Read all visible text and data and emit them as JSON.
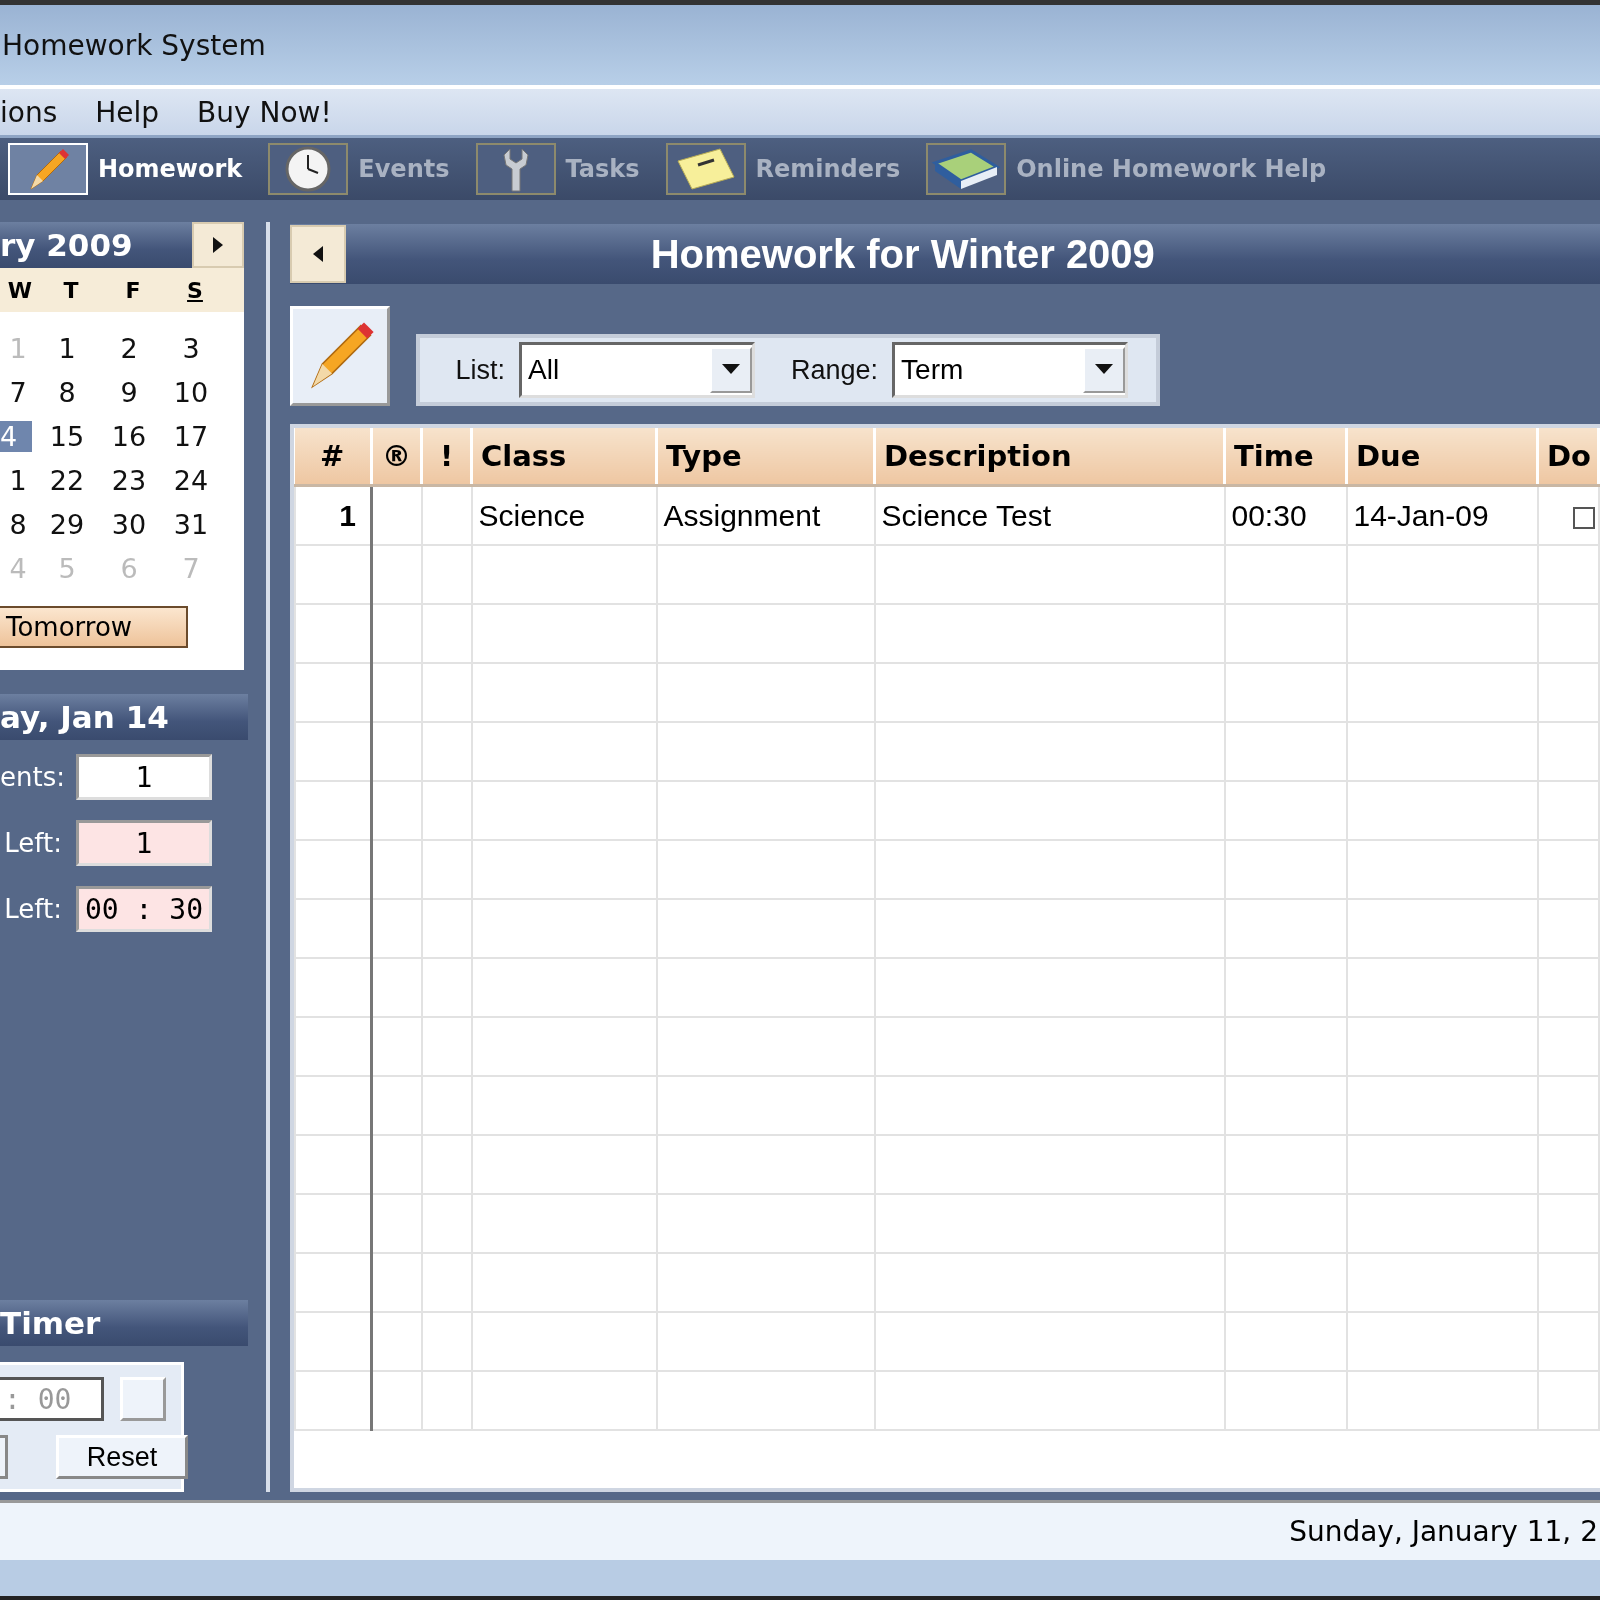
{
  "window": {
    "title": "Homework System"
  },
  "menu": [
    "ions",
    "Help",
    "Buy Now!"
  ],
  "toolbar": [
    {
      "label": "Homework",
      "selected": true
    },
    {
      "label": "Events",
      "selected": false
    },
    {
      "label": "Tasks",
      "selected": false
    },
    {
      "label": "Reminders",
      "selected": false
    },
    {
      "label": "Online Homework Help",
      "selected": false
    }
  ],
  "calendar": {
    "month": "ry 2009",
    "weekdays": [
      "W",
      "T",
      "F",
      "S"
    ],
    "days": [
      [
        {
          "text": "1",
          "muted": true,
          "selected": false
        },
        {
          "text": "1",
          "muted": false,
          "selected": false
        },
        {
          "text": "2",
          "muted": false,
          "selected": false
        },
        {
          "text": "3",
          "muted": false,
          "selected": false
        }
      ],
      [
        {
          "text": "7",
          "muted": false,
          "selected": false
        },
        {
          "text": "8",
          "muted": false,
          "selected": false
        },
        {
          "text": "9",
          "muted": false,
          "selected": false
        },
        {
          "text": "10",
          "muted": false,
          "selected": false
        }
      ],
      [
        {
          "text": "4",
          "muted": false,
          "selected": true
        },
        {
          "text": "15",
          "muted": false,
          "selected": false
        },
        {
          "text": "16",
          "muted": false,
          "selected": false
        },
        {
          "text": "17",
          "muted": false,
          "selected": false
        }
      ],
      [
        {
          "text": "1",
          "muted": false,
          "selected": false
        },
        {
          "text": "22",
          "muted": false,
          "selected": false
        },
        {
          "text": "23",
          "muted": false,
          "selected": false
        },
        {
          "text": "24",
          "muted": false,
          "selected": false
        }
      ],
      [
        {
          "text": "8",
          "muted": false,
          "selected": false
        },
        {
          "text": "29",
          "muted": false,
          "selected": false
        },
        {
          "text": "30",
          "muted": false,
          "selected": false
        },
        {
          "text": "31",
          "muted": false,
          "selected": false
        }
      ],
      [
        {
          "text": "4",
          "muted": true,
          "selected": false
        },
        {
          "text": "5",
          "muted": true,
          "selected": false
        },
        {
          "text": "6",
          "muted": true,
          "selected": false
        },
        {
          "text": "7",
          "muted": true,
          "selected": false
        }
      ]
    ],
    "button": "Tomorrow"
  },
  "day": {
    "title": "ay, Jan 14",
    "stats": [
      {
        "label": "ents:",
        "value": "1",
        "alert": false
      },
      {
        "label": "Left:",
        "value": "1",
        "alert": true
      },
      {
        "label": "Left:",
        "value": "00 : 30",
        "alert": true
      }
    ]
  },
  "timer": {
    "title": "Timer",
    "display": ": 00",
    "button": "Reset"
  },
  "main": {
    "title": "Homework for Winter 2009",
    "filters": [
      {
        "label": "List:",
        "value": "All"
      },
      {
        "label": "Range:",
        "value": "Term"
      }
    ],
    "columns": [
      "#",
      "®",
      "!",
      "Class",
      "Type",
      "Description",
      "Time",
      "Due",
      "Do"
    ],
    "rows": [
      {
        "cells": [
          "1",
          "",
          "",
          "Science",
          "Assignment",
          "Science Test",
          "00:30",
          "14-Jan-09"
        ],
        "done": false
      }
    ]
  },
  "status_bar": "Sunday, January 11, 2"
}
